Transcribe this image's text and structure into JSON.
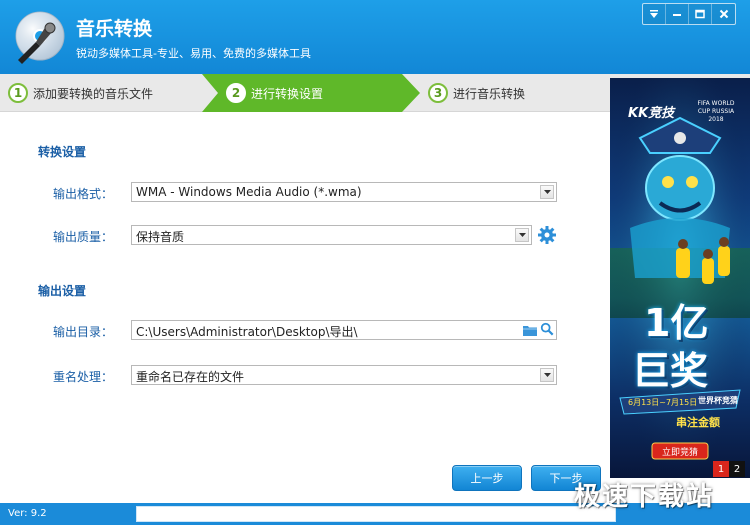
{
  "window": {
    "title": "音乐转换",
    "subtitle": "锐动多媒体工具-专业、易用、免费的多媒体工具",
    "controls": [
      "menu-icon",
      "minimize-icon",
      "maximize-icon",
      "close-icon"
    ]
  },
  "steps": [
    {
      "num": "1",
      "label": "添加要转换的音乐文件",
      "active": false
    },
    {
      "num": "2",
      "label": "进行转换设置",
      "active": true
    },
    {
      "num": "3",
      "label": "进行音乐转换",
      "active": false
    }
  ],
  "conversion": {
    "section_title": "转换设置",
    "format_label": "输出格式：",
    "format_value": "WMA - Windows Media Audio (*.wma)",
    "quality_label": "输出质量：",
    "quality_value": "保持音质"
  },
  "output": {
    "section_title": "输出设置",
    "dir_label": "输出目录：",
    "dir_value": "C:\\Users\\Administrator\\Desktop\\导出\\",
    "rename_label": "重名处理：",
    "rename_value": "重命名已存在的文件"
  },
  "buttons": {
    "prev": "上一步",
    "next": "下一步"
  },
  "ad": {
    "brand": "KK竞技",
    "event": "FIFA WORLD CUP RUSSIA 2018",
    "headline_1": "1亿",
    "headline_2": "巨奖",
    "date_range": "6月13日~7月15日",
    "tagline": "世界杯竞猜",
    "slogan": "串注金额",
    "cta": "立即竞猜",
    "pages": [
      "1",
      "2"
    ],
    "active_page": "1"
  },
  "footer": {
    "version": "Ver: 9.2",
    "watermark": "极速下载站"
  },
  "colors": {
    "titlebar": "#1e9fe8",
    "step_active": "#5fb829",
    "label_blue": "#1b5fa6",
    "button_blue": "#1285d4"
  }
}
